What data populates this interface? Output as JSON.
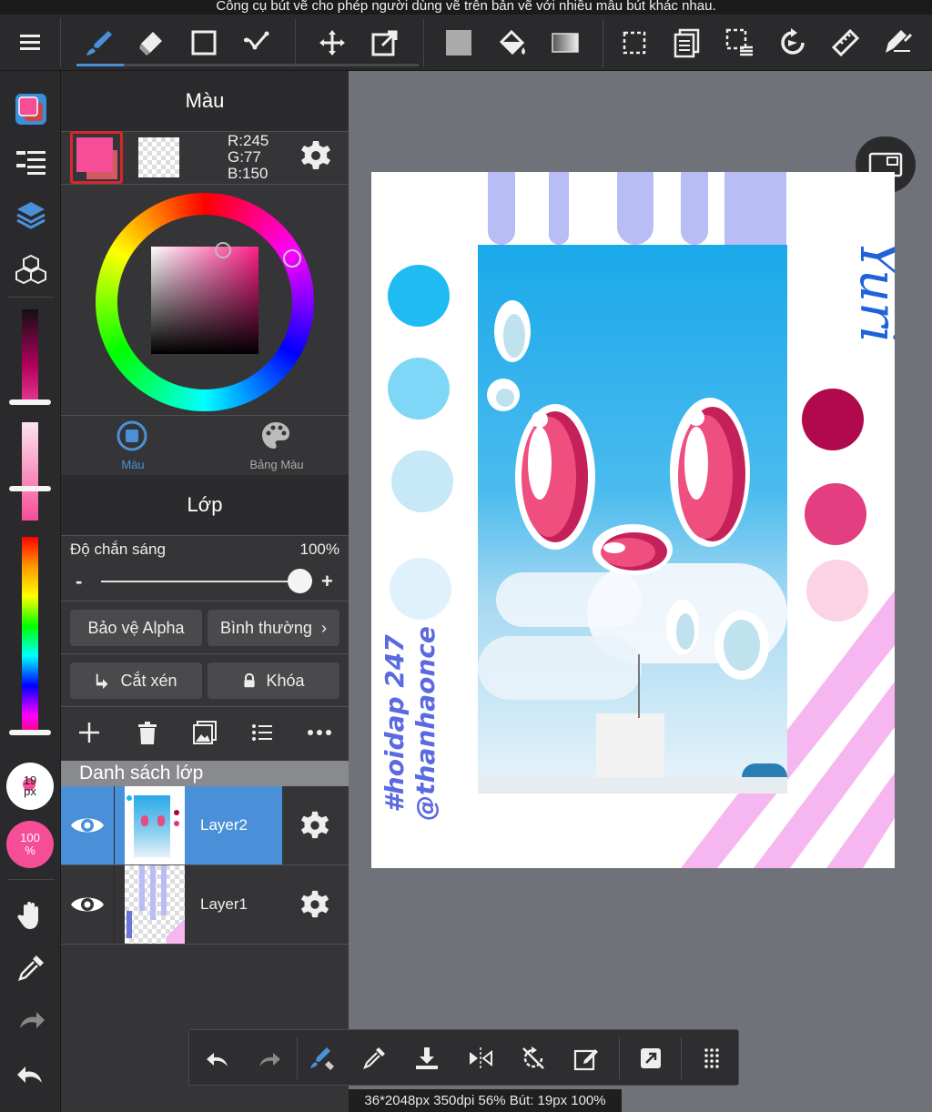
{
  "caption": "Công cụ bút vẽ cho phép người dùng vẽ trên bản vẽ với nhiều mẫu bút khác nhau.",
  "colors": {
    "accent": "#4a90d9",
    "current_color": "#f54d96",
    "panel_bg": "#353538",
    "toolbar_bg": "#2a2a2c"
  },
  "toolbar": {
    "icons": [
      "menu-icon",
      "brush-icon",
      "eraser-icon",
      "shape-icon",
      "dot-icon",
      "move-icon",
      "transform-icon",
      "fill-color-icon",
      "bucket-icon",
      "gradient-icon",
      "select-icon",
      "layer-copy-icon",
      "select-mode-icon",
      "rotate-icon",
      "ruler-icon",
      "snap-icon"
    ]
  },
  "color_panel": {
    "title": "Màu",
    "rgb_r": "R:245",
    "rgb_g": "G:77",
    "rgb_b": "B:150",
    "tab_color": "Màu",
    "tab_palette": "Bảng Màu"
  },
  "layer_panel": {
    "title": "Lớp",
    "opacity_label": "Độ chắn sáng",
    "opacity_value": "100%",
    "opacity_fraction": 1.0,
    "minus": "-",
    "plus": "+",
    "alpha_protect": "Bảo vệ Alpha",
    "blend_mode": "Bình thường",
    "clip": "Cắt xén",
    "lock": "Khóa",
    "list_title": "Danh sách lớp",
    "layers": [
      {
        "name": "Layer2",
        "selected": true
      },
      {
        "name": "Layer1",
        "selected": false
      }
    ]
  },
  "rail": {
    "brush_size": "19\npx",
    "opacity": "100\n%"
  },
  "canvas": {
    "signature_left": "#hoidap 247\n@thanhaonce",
    "signature_right": "Yuri"
  },
  "status": "36*2048px 350dpi 56% Bút: 19px 100%"
}
